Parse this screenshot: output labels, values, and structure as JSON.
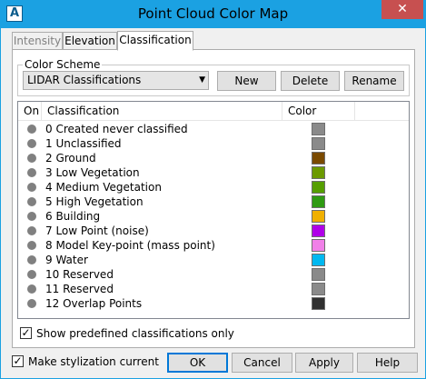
{
  "window": {
    "title": "Point Cloud Color Map",
    "icon_letter": "A",
    "close_glyph": "✕"
  },
  "tabs": [
    {
      "label": "Intensity",
      "state": "disabled"
    },
    {
      "label": "Elevation",
      "state": "normal"
    },
    {
      "label": "Classification",
      "state": "active"
    }
  ],
  "color_scheme": {
    "legend": "Color Scheme",
    "selected": "LIDAR Classifications",
    "arrow_glyph": "▼",
    "buttons": {
      "new": "New",
      "delete": "Delete",
      "rename": "Rename"
    }
  },
  "table": {
    "columns": [
      "On",
      "Classification",
      "Color"
    ],
    "rows": [
      {
        "label": "0 Created never classified",
        "color": "#8a8a8a"
      },
      {
        "label": "1 Unclassified",
        "color": "#8a8a8a"
      },
      {
        "label": "2 Ground",
        "color": "#7a4a00"
      },
      {
        "label": "3 Low Vegetation",
        "color": "#6b9a00"
      },
      {
        "label": "4 Medium Vegetation",
        "color": "#559e00"
      },
      {
        "label": "5 High Vegetation",
        "color": "#2e9a12"
      },
      {
        "label": "6 Building",
        "color": "#f0b000"
      },
      {
        "label": "7 Low Point (noise)",
        "color": "#b000e8"
      },
      {
        "label": "8 Model Key-point (mass point)",
        "color": "#f080e8"
      },
      {
        "label": "9 Water",
        "color": "#00b8f0"
      },
      {
        "label": "10 Reserved",
        "color": "#8a8a8a"
      },
      {
        "label": "11 Reserved",
        "color": "#8a8a8a"
      },
      {
        "label": "12 Overlap Points",
        "color": "#303030"
      }
    ]
  },
  "show_predefined": {
    "label": "Show predefined classifications only",
    "checked": true,
    "glyph": "✓"
  },
  "footer": {
    "make_current": {
      "label": "Make stylization current",
      "checked": true,
      "glyph": "✓"
    },
    "ok": "OK",
    "cancel": "Cancel",
    "apply": "Apply",
    "help": "Help"
  },
  "colors": {
    "title_bar": "#1ba1e2",
    "close_button": "#c75050",
    "default_button_border": "#0078d7"
  }
}
